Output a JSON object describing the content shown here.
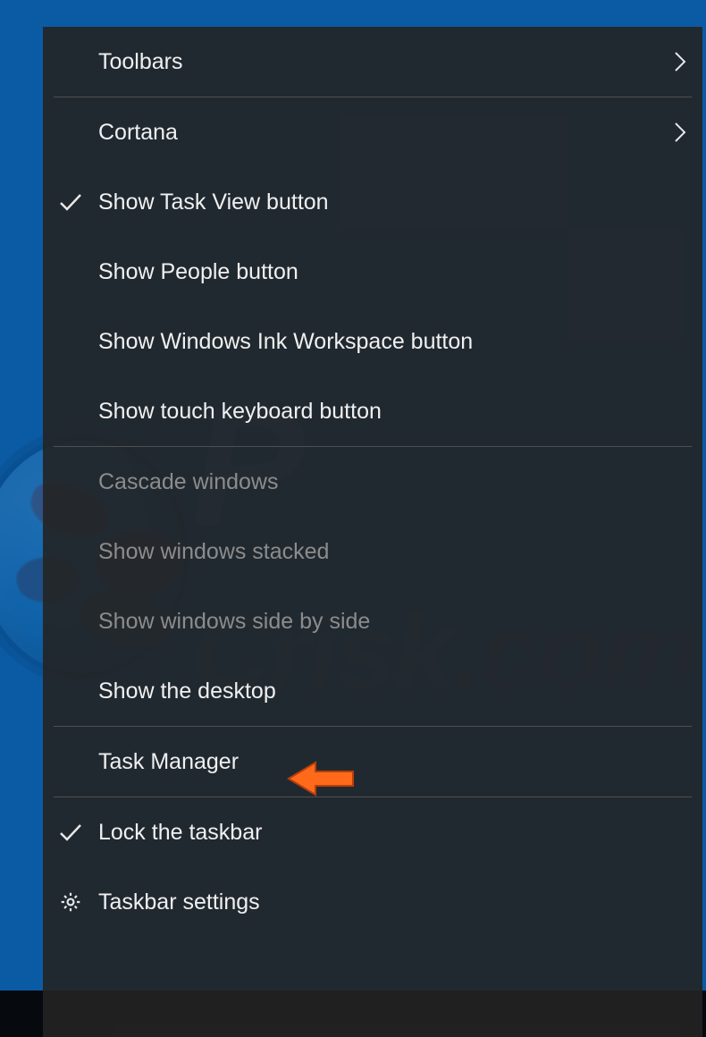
{
  "watermark": {
    "prefix": "P",
    "middle": "Crisk",
    "suffix": ".com"
  },
  "menu": {
    "items": [
      {
        "label": "Toolbars",
        "icon": null,
        "submenu": true,
        "enabled": true
      },
      {
        "label": "Cortana",
        "icon": null,
        "submenu": true,
        "enabled": true
      },
      {
        "label": "Show Task View button",
        "icon": "check",
        "submenu": false,
        "enabled": true
      },
      {
        "label": "Show People button",
        "icon": null,
        "submenu": false,
        "enabled": true
      },
      {
        "label": "Show Windows Ink Workspace button",
        "icon": null,
        "submenu": false,
        "enabled": true
      },
      {
        "label": "Show touch keyboard button",
        "icon": null,
        "submenu": false,
        "enabled": true
      },
      {
        "label": "Cascade windows",
        "icon": null,
        "submenu": false,
        "enabled": false
      },
      {
        "label": "Show windows stacked",
        "icon": null,
        "submenu": false,
        "enabled": false
      },
      {
        "label": "Show windows side by side",
        "icon": null,
        "submenu": false,
        "enabled": false
      },
      {
        "label": "Show the desktop",
        "icon": null,
        "submenu": false,
        "enabled": true
      },
      {
        "label": "Task Manager",
        "icon": null,
        "submenu": false,
        "enabled": true
      },
      {
        "label": "Lock the taskbar",
        "icon": "check",
        "submenu": false,
        "enabled": true
      },
      {
        "label": "Taskbar settings",
        "icon": "gear",
        "submenu": false,
        "enabled": true
      }
    ]
  },
  "annotation": {
    "arrow_color_fill": "#ff6a1a",
    "arrow_color_stroke": "#b83e0a",
    "points_to": "Task Manager"
  }
}
